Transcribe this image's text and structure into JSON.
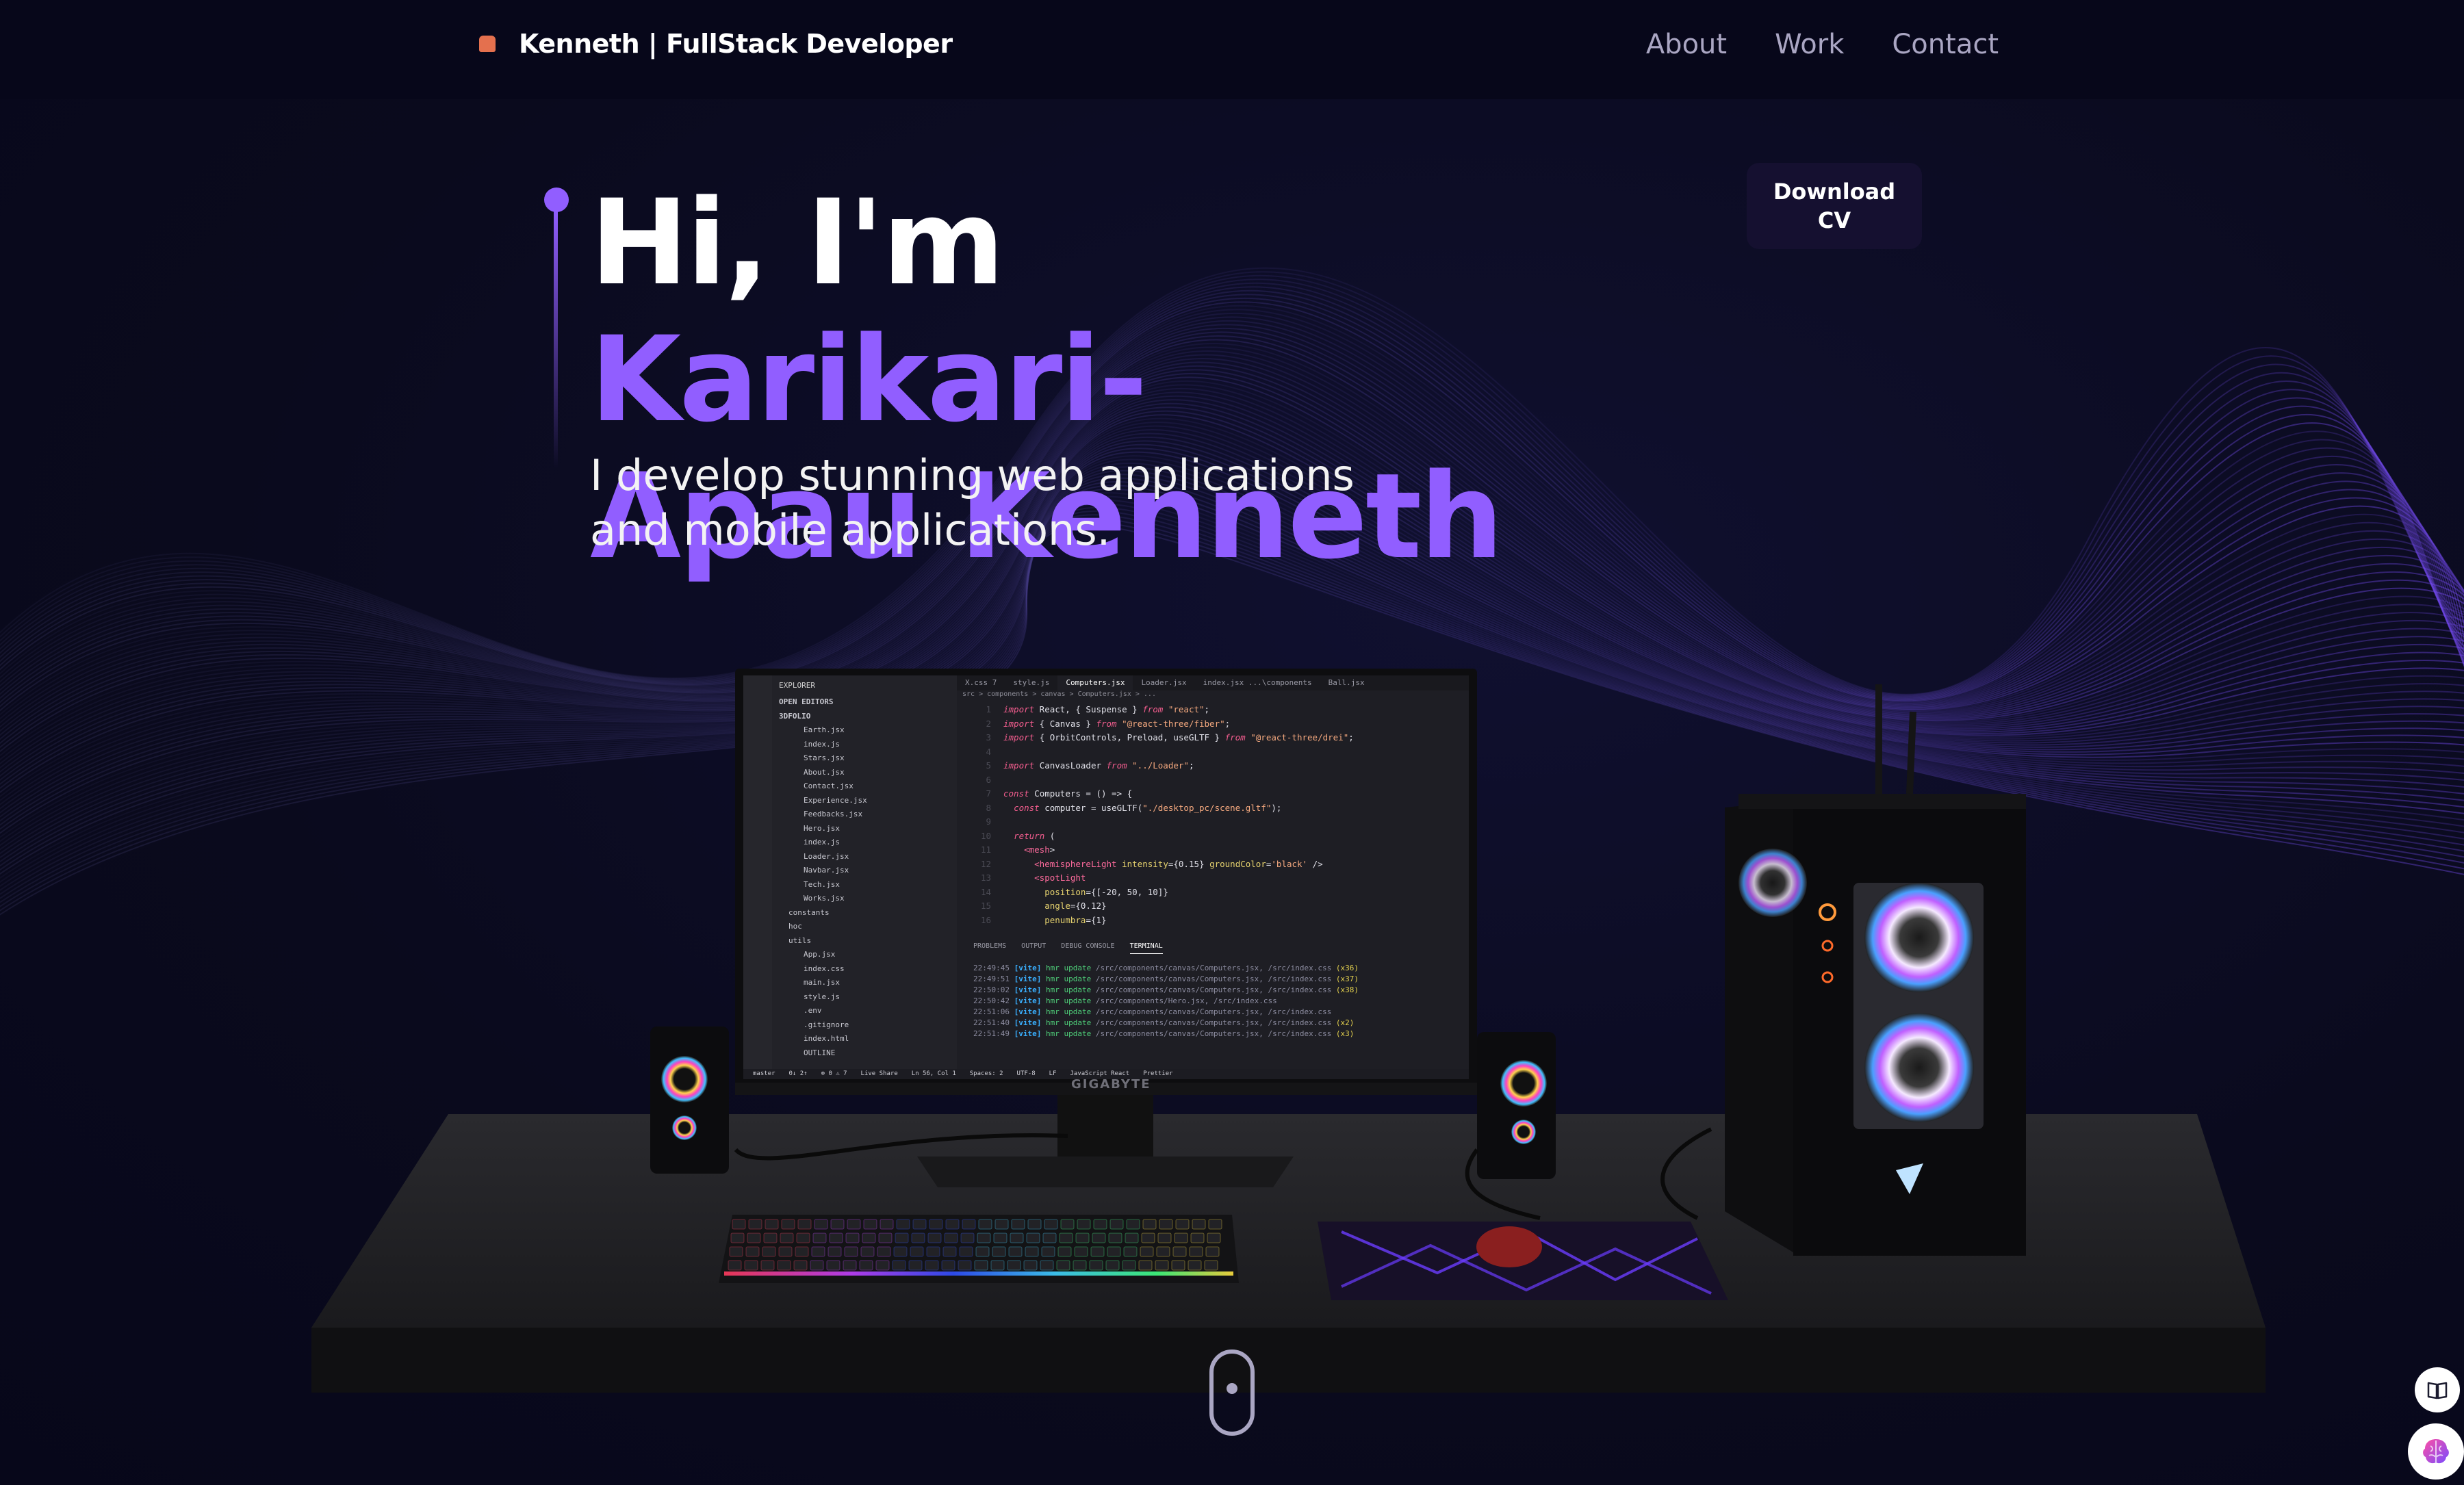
{
  "navbar": {
    "logo_text": "Kenneth  | FullStack Developer",
    "links": [
      {
        "label": "About"
      },
      {
        "label": "Work"
      },
      {
        "label": "Contact"
      }
    ]
  },
  "hero": {
    "greeting": "Hi, I'm ",
    "name_first": "Karikari-",
    "name_last": "Apau Kenneth",
    "subtitle_line1": "I develop stunning web applications",
    "subtitle_line2": "and mobile applications.",
    "download_cv_label": "Download CV"
  },
  "editor": {
    "explorer_header": "EXPLORER",
    "open_editors": "OPEN EDITORS",
    "project": "3DFOLIO",
    "files": [
      "Earth.jsx",
      "index.js",
      "Stars.jsx",
      "About.jsx",
      "Contact.jsx",
      "Experience.jsx",
      "Feedbacks.jsx",
      "Hero.jsx",
      "index.js",
      "Loader.jsx",
      "Navbar.jsx",
      "Tech.jsx",
      "Works.jsx",
      "constants",
      "hoc",
      "utils",
      "App.jsx",
      "index.css",
      "main.jsx",
      "style.js",
      ".env",
      ".gitignore",
      "index.html",
      "OUTLINE"
    ],
    "tabs": [
      "X.css 7",
      "style.js",
      "Computers.jsx",
      "Loader.jsx",
      "index.jsx ...\\components",
      "Ball.jsx"
    ],
    "breadcrumb": "src > components > canvas > Computers.jsx > ...",
    "code_lines": [
      {
        "n": "1",
        "t": "import React, { Suspense } from \"react\";"
      },
      {
        "n": "2",
        "t": "import { Canvas } from \"@react-three/fiber\";"
      },
      {
        "n": "3",
        "t": "import { OrbitControls, Preload, useGLTF } from \"@react-three/drei\";"
      },
      {
        "n": "4",
        "t": ""
      },
      {
        "n": "5",
        "t": "import CanvasLoader from \"../Loader\";"
      },
      {
        "n": "6",
        "t": ""
      },
      {
        "n": "7",
        "t": "const Computers = () => {"
      },
      {
        "n": "8",
        "t": "  const computer = useGLTF(\"./desktop_pc/scene.gltf\");"
      },
      {
        "n": "9",
        "t": ""
      },
      {
        "n": "10",
        "t": "  return ("
      },
      {
        "n": "11",
        "t": "    <mesh>"
      },
      {
        "n": "12",
        "t": "      <hemisphereLight intensity={0.15} groundColor='black' />"
      },
      {
        "n": "13",
        "t": "      <spotLight"
      },
      {
        "n": "14",
        "t": "        position={[-20, 50, 10]}"
      },
      {
        "n": "15",
        "t": "        angle={0.12}"
      },
      {
        "n": "16",
        "t": "        penumbra={1}"
      }
    ],
    "panel_tabs": [
      "PROBLEMS",
      "OUTPUT",
      "DEBUG CONSOLE",
      "TERMINAL"
    ],
    "terminal_lines": [
      {
        "time": "22:49:45",
        "file": "/src/components/canvas/Computers.jsx, /src/index.css",
        "count": "(x36)"
      },
      {
        "time": "22:49:51",
        "file": "/src/components/canvas/Computers.jsx, /src/index.css",
        "count": "(x37)"
      },
      {
        "time": "22:50:02",
        "file": "/src/components/canvas/Computers.jsx, /src/index.css",
        "count": "(x38)"
      },
      {
        "time": "22:50:42",
        "file": "/src/components/Hero.jsx, /src/index.css",
        "count": ""
      },
      {
        "time": "22:51:06",
        "file": "/src/components/canvas/Computers.jsx, /src/index.css",
        "count": ""
      },
      {
        "time": "22:51:40",
        "file": "/src/components/canvas/Computers.jsx, /src/index.css",
        "count": "(x2)"
      },
      {
        "time": "22:51:49",
        "file": "/src/components/canvas/Computers.jsx, /src/index.css",
        "count": "(x3)"
      }
    ],
    "terminal_tag": "[vite]",
    "terminal_hmr": "hmr update",
    "status_items": [
      "master",
      "0↓ 2↑",
      "⊗ 0 ⚠ 7",
      "Live Share",
      "Ln 56, Col 1",
      "Spaces: 2",
      "UTF-8",
      "LF",
      "JavaScript React",
      "Prettier"
    ],
    "monitor_brand": "GIGABYTE"
  },
  "colors": {
    "accent": "#915eff",
    "background": "#0b0a1e",
    "nav_text": "#aaa6c3",
    "cv_button_bg": "#151030"
  },
  "icons": {
    "logo": "logo-mark-icon",
    "scroll": "mouse-scroll-icon",
    "book": "book-icon",
    "brain": "brain-icon"
  }
}
